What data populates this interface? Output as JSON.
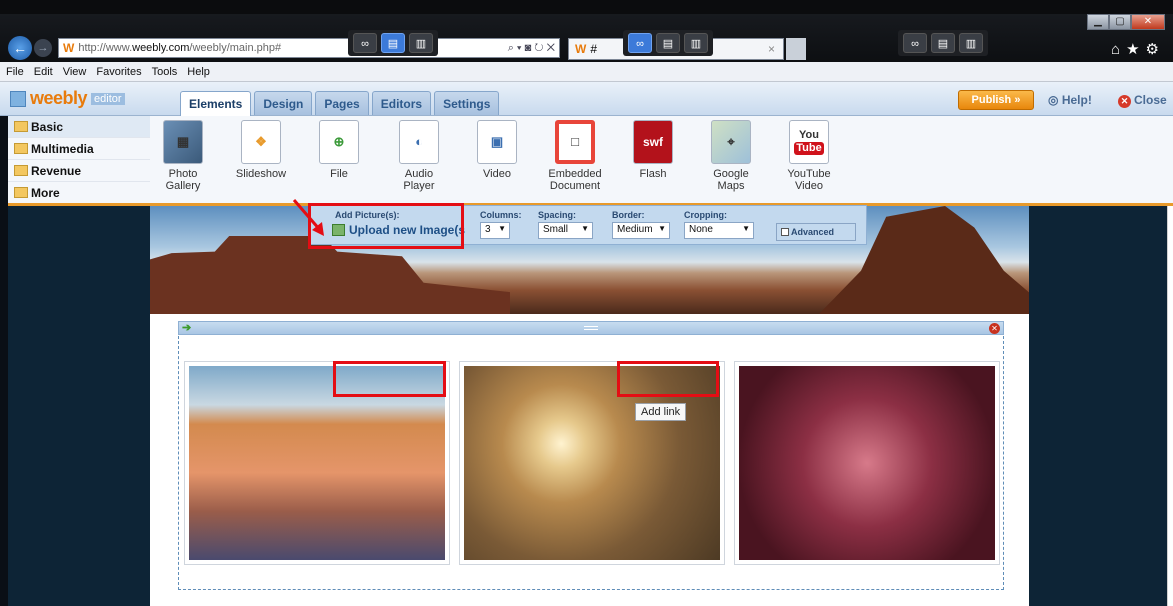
{
  "browser": {
    "url_prefix": "http://www.",
    "url_domain": "weebly.com",
    "url_path": "/weebly/main.php#",
    "search_controls": "⌕ ▾ ◙ ↻ ✕",
    "tab_title": "#",
    "tab_close": "×"
  },
  "menubar": [
    "File",
    "Edit",
    "View",
    "Favorites",
    "Tools",
    "Help"
  ],
  "editor": {
    "logo": "weebly",
    "logo_suffix": "editor",
    "tabs": [
      "Elements",
      "Design",
      "Pages",
      "Editors",
      "Settings"
    ],
    "active_tab": "Elements",
    "publish": "Publish »",
    "help": "Help!",
    "close": "Close"
  },
  "sidebar": [
    "Basic",
    "Multimedia",
    "Revenue",
    "More"
  ],
  "elements": [
    {
      "label": "Photo\nGallery",
      "icon": "photo-gallery-icon"
    },
    {
      "label": "Slideshow",
      "icon": "slideshow-icon"
    },
    {
      "label": "File",
      "icon": "file-icon"
    },
    {
      "label": "Audio\nPlayer",
      "icon": "audio-player-icon"
    },
    {
      "label": "Video",
      "icon": "video-icon"
    },
    {
      "label": "Embedded\nDocument",
      "icon": "embedded-document-icon"
    },
    {
      "label": "Flash",
      "icon": "flash-icon"
    },
    {
      "label": "Google\nMaps",
      "icon": "google-maps-icon"
    },
    {
      "label": "YouTube\nVideo",
      "icon": "youtube-icon"
    }
  ],
  "element_icon_text": {
    "flash": "swf",
    "youtube_top": "You",
    "youtube_bottom": "Tube"
  },
  "gallery_props": {
    "add_pictures_label": "Add Picture(s):",
    "upload_label": "Upload new Image(s",
    "columns_label": "Columns:",
    "columns_value": "3",
    "spacing_label": "Spacing:",
    "spacing_value": "Small",
    "border_label": "Border:",
    "border_value": "Medium",
    "cropping_label": "Cropping:",
    "cropping_value": "None",
    "advanced_label": "Advanced"
  },
  "tooltip": "Add link",
  "colors": {
    "accent_orange": "#e89a2b",
    "highlight_red": "#e40d14",
    "active_blue": "#3c7ad9"
  }
}
